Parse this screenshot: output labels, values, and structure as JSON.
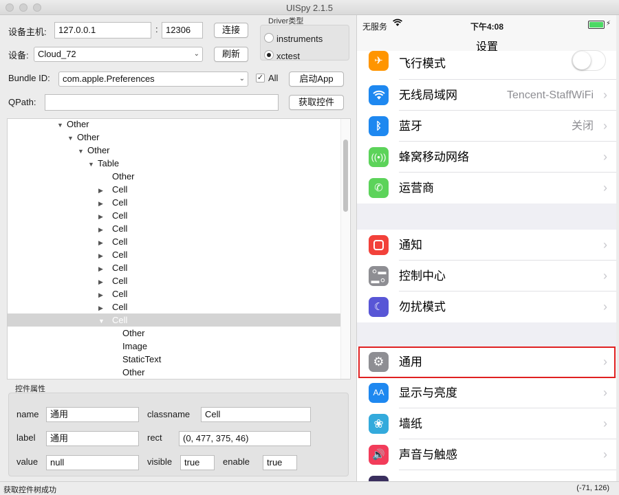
{
  "window": {
    "title": "UISpy 2.1.5"
  },
  "connection": {
    "host_label": "设备主机:",
    "host_value": "127.0.0.1",
    "port_separator": ":",
    "port_value": "12306",
    "connect_label": "连接",
    "device_label": "设备:",
    "device_value": "Cloud_72",
    "refresh_label": "刷新",
    "bundle_label": "Bundle ID:",
    "bundle_value": "com.apple.Preferences",
    "all_label": "All",
    "all_checked": true,
    "launch_label": "启动App",
    "qpath_label": "QPath:",
    "qpath_value": "",
    "get_tree_label": "获取控件"
  },
  "driver": {
    "title": "Driver类型",
    "options": [
      {
        "label": "instruments",
        "selected": false
      },
      {
        "label": "xctest",
        "selected": true
      }
    ]
  },
  "tree": {
    "rows": [
      {
        "label": "Other",
        "expanded": true,
        "depth": 0
      },
      {
        "label": "Other",
        "expanded": true,
        "depth": 1
      },
      {
        "label": "Other",
        "expanded": true,
        "depth": 2
      },
      {
        "label": "Table",
        "expanded": true,
        "depth": 3
      },
      {
        "label": "Other",
        "expanded": null,
        "depth": 4
      },
      {
        "label": "Cell",
        "expanded": false,
        "depth": 4
      },
      {
        "label": "Cell",
        "expanded": false,
        "depth": 4
      },
      {
        "label": "Cell",
        "expanded": false,
        "depth": 4
      },
      {
        "label": "Cell",
        "expanded": false,
        "depth": 4
      },
      {
        "label": "Cell",
        "expanded": false,
        "depth": 4
      },
      {
        "label": "Cell",
        "expanded": false,
        "depth": 4
      },
      {
        "label": "Cell",
        "expanded": false,
        "depth": 4
      },
      {
        "label": "Cell",
        "expanded": false,
        "depth": 4
      },
      {
        "label": "Cell",
        "expanded": false,
        "depth": 4
      },
      {
        "label": "Cell",
        "expanded": false,
        "depth": 4
      },
      {
        "label": "Cell",
        "expanded": true,
        "depth": 4,
        "selected": true
      },
      {
        "label": "Other",
        "expanded": null,
        "depth": 5
      },
      {
        "label": "Image",
        "expanded": null,
        "depth": 5
      },
      {
        "label": "StaticText",
        "expanded": null,
        "depth": 5
      },
      {
        "label": "Other",
        "expanded": null,
        "depth": 5
      }
    ]
  },
  "properties": {
    "title": "控件属性",
    "name_label": "name",
    "name_value": "通用",
    "classname_label": "classname",
    "classname_value": "Cell",
    "label_label": "label",
    "label_value": "通用",
    "rect_label": "rect",
    "rect_value": "(0, 477, 375, 46)",
    "value_label": "value",
    "value_value": "null",
    "visible_label": "visible",
    "visible_value": "true",
    "enable_label": "enable",
    "enable_value": "true"
  },
  "status": {
    "message": "获取控件树成功",
    "coords": "(-71, 126)"
  },
  "phone": {
    "carrier": "无服务",
    "time": "下午4:08",
    "nav_title": "设置",
    "rows": [
      {
        "title": "飞行模式",
        "value": "",
        "icon": "airplane-icon",
        "color": "#ff9500",
        "toggle": true
      },
      {
        "title": "无线局域网",
        "value": "Tencent-StaffWiFi",
        "icon": "wifi-icon",
        "color": "#1e88f0"
      },
      {
        "title": "蓝牙",
        "value": "关闭",
        "icon": "bluetooth-icon",
        "color": "#1e88f0"
      },
      {
        "title": "蜂窝移动网络",
        "value": "",
        "icon": "cellular-icon",
        "color": "#5cd35a"
      },
      {
        "title": "运营商",
        "value": "",
        "icon": "phone-icon",
        "color": "#5cd35a"
      },
      {
        "title": "通知",
        "value": "",
        "icon": "notification-icon",
        "color": "#f2413a"
      },
      {
        "title": "控制中心",
        "value": "",
        "icon": "control-center-icon",
        "color": "#8e8e93"
      },
      {
        "title": "勿扰模式",
        "value": "",
        "icon": "moon-icon",
        "color": "#5856d6"
      },
      {
        "title": "通用",
        "value": "",
        "icon": "gear-icon",
        "color": "#8e8e93"
      },
      {
        "title": "显示与亮度",
        "value": "",
        "icon": "display-icon",
        "color": "#1e88f0"
      },
      {
        "title": "墙纸",
        "value": "",
        "icon": "wallpaper-icon",
        "color": "#33aadc"
      },
      {
        "title": "声音与触感",
        "value": "",
        "icon": "sound-icon",
        "color": "#f23c5a"
      }
    ]
  }
}
